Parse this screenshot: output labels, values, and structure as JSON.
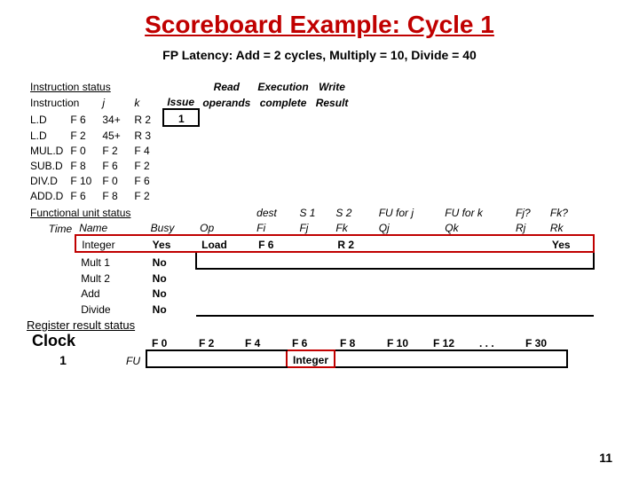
{
  "title": "Scoreboard Example:  Cycle 1",
  "subtitle": "FP Latency:  Add = 2 cycles, Multiply = 10, Divide = 40",
  "instr_status": {
    "header": "Instruction status",
    "cols": {
      "instr": "Instruction",
      "j": "j",
      "k": "k",
      "issue": "Issue",
      "read": "Read operands",
      "exec": "Execution complete",
      "write": "Write Result"
    },
    "rows": [
      {
        "op": "L.D",
        "dest": "F 6",
        "j": "34+",
        "k": "R 2",
        "issue": "1"
      },
      {
        "op": "L.D",
        "dest": "F 2",
        "j": "45+",
        "k": "R 3"
      },
      {
        "op": "MUL.D",
        "dest": "F 0",
        "j": "F 2",
        "k": "F 4"
      },
      {
        "op": "SUB.D",
        "dest": "F 8",
        "j": "F 6",
        "k": "F 2"
      },
      {
        "op": "DIV.D",
        "dest": "F 10",
        "j": "F 0",
        "k": "F 6"
      },
      {
        "op": "ADD.D",
        "dest": "F 6",
        "j": "F 8",
        "k": "F 2"
      }
    ]
  },
  "fu_status": {
    "header": "Functional unit status",
    "cols": {
      "time": "Time",
      "name": "Name",
      "busy": "Busy",
      "op": "Op",
      "fi": "Fi",
      "fj": "Fj",
      "fk": "Fk",
      "qj": "Qj",
      "qk": "Qk",
      "rj": "Rj",
      "rk": "Rk",
      "dest": "dest",
      "s1": "S 1",
      "s2": "S 2",
      "fu_j": "FU for j",
      "fu_k": "FU for k",
      "fjq": "Fj?",
      "fkq": "Fk?"
    },
    "rows": [
      {
        "name": "Integer",
        "busy": "Yes",
        "op": "Load",
        "fi": "F 6",
        "fk": "R 2",
        "rk": "Yes"
      },
      {
        "name": "Mult 1",
        "busy": "No"
      },
      {
        "name": "Mult 2",
        "busy": "No"
      },
      {
        "name": "Add",
        "busy": "No"
      },
      {
        "name": "Divide",
        "busy": "No"
      }
    ]
  },
  "reg_status": {
    "header": "Register result status",
    "clock_label": "Clock",
    "clock": "1",
    "fu_label": "FU",
    "regs": [
      "F 0",
      "F 2",
      "F 4",
      "F 6",
      "F 8",
      "F 10",
      "F 12",
      ". . .",
      "F 30"
    ],
    "vals": [
      "",
      "",
      "",
      "Integer",
      "",
      "",
      "",
      "",
      ""
    ]
  },
  "page": "11"
}
